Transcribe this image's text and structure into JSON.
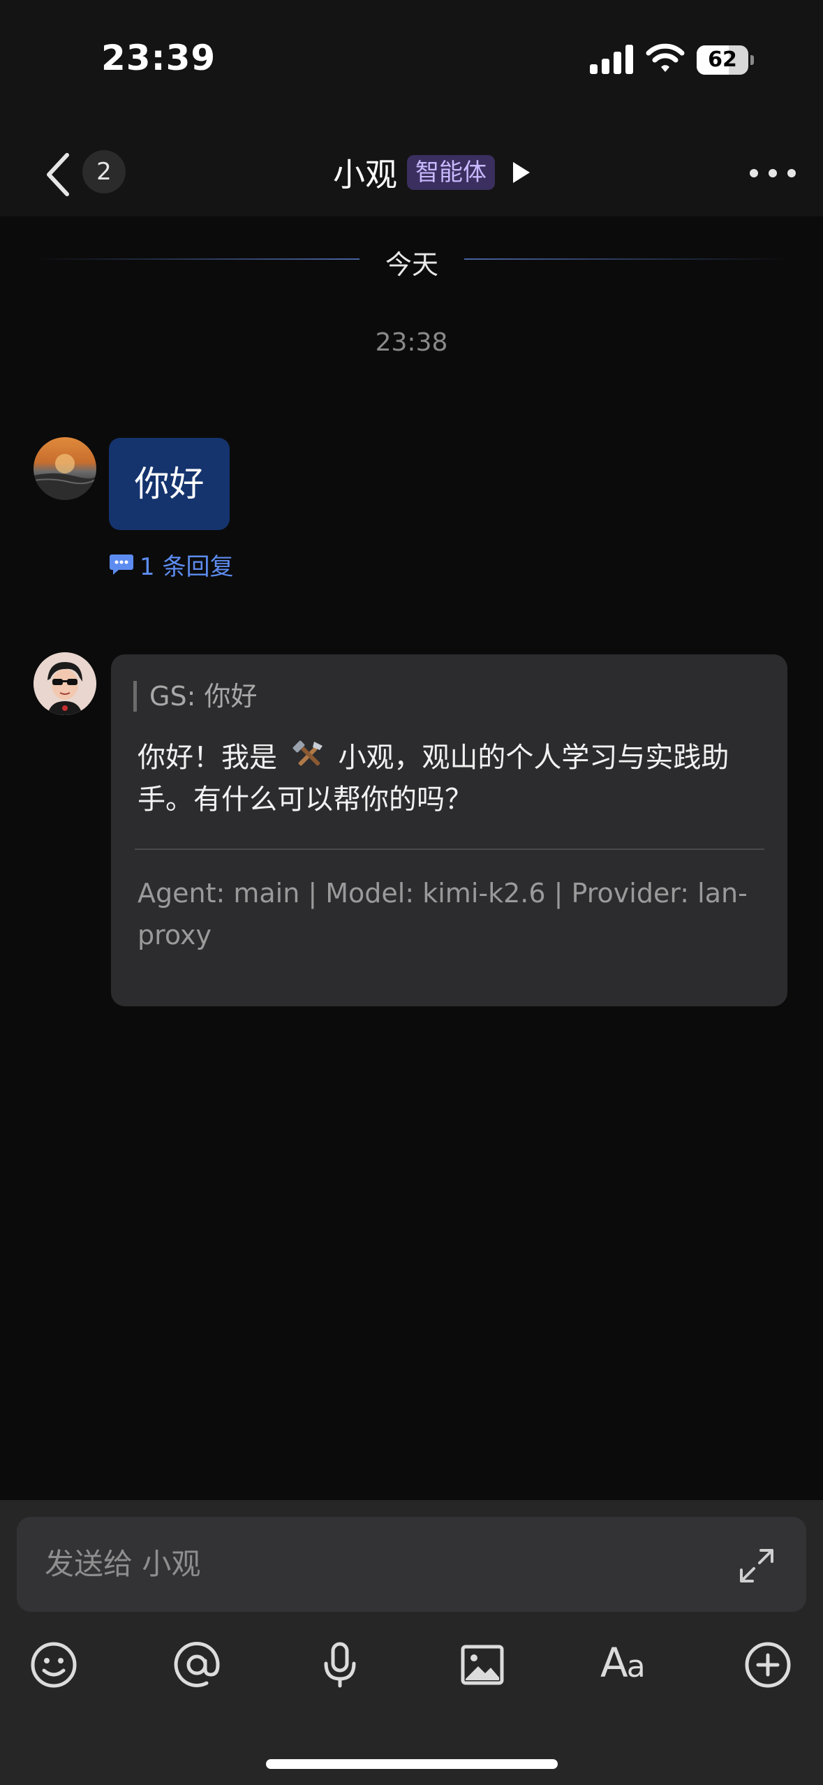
{
  "status_bar": {
    "time": "23:39",
    "battery": "62",
    "battery_level": 0.62
  },
  "header": {
    "back_count": "2",
    "title": "小观",
    "badge": "智能体"
  },
  "chat": {
    "date_divider": "今天",
    "timestamp": "23:38",
    "user_message": {
      "text": "你好",
      "reply_count_label": "1 条回复"
    },
    "bot_message": {
      "quote": "GS: 你好",
      "text_before_icon": "你好！我是",
      "text_after_icon": "小观，观山的个人学习与实践助手。有什么可以帮你的吗？",
      "meta": "Agent: main | Model: kimi-k2.6 | Provider: lan-proxy"
    }
  },
  "composer": {
    "placeholder": "发送给 小观",
    "aa_label_big": "A",
    "aa_label_small": "a"
  },
  "colors": {
    "accent_link": "#5d8cf0",
    "user_bubble": "#15346e",
    "agent_badge_bg": "#3a2f5e",
    "agent_badge_text": "#c8b8ff"
  },
  "icons": [
    "back-chevron-icon",
    "play-icon",
    "more-icon",
    "reply-icon",
    "tools-icon",
    "expand-icon",
    "emoji-icon",
    "at-icon",
    "microphone-icon",
    "image-icon",
    "text-format-icon",
    "plus-icon"
  ]
}
